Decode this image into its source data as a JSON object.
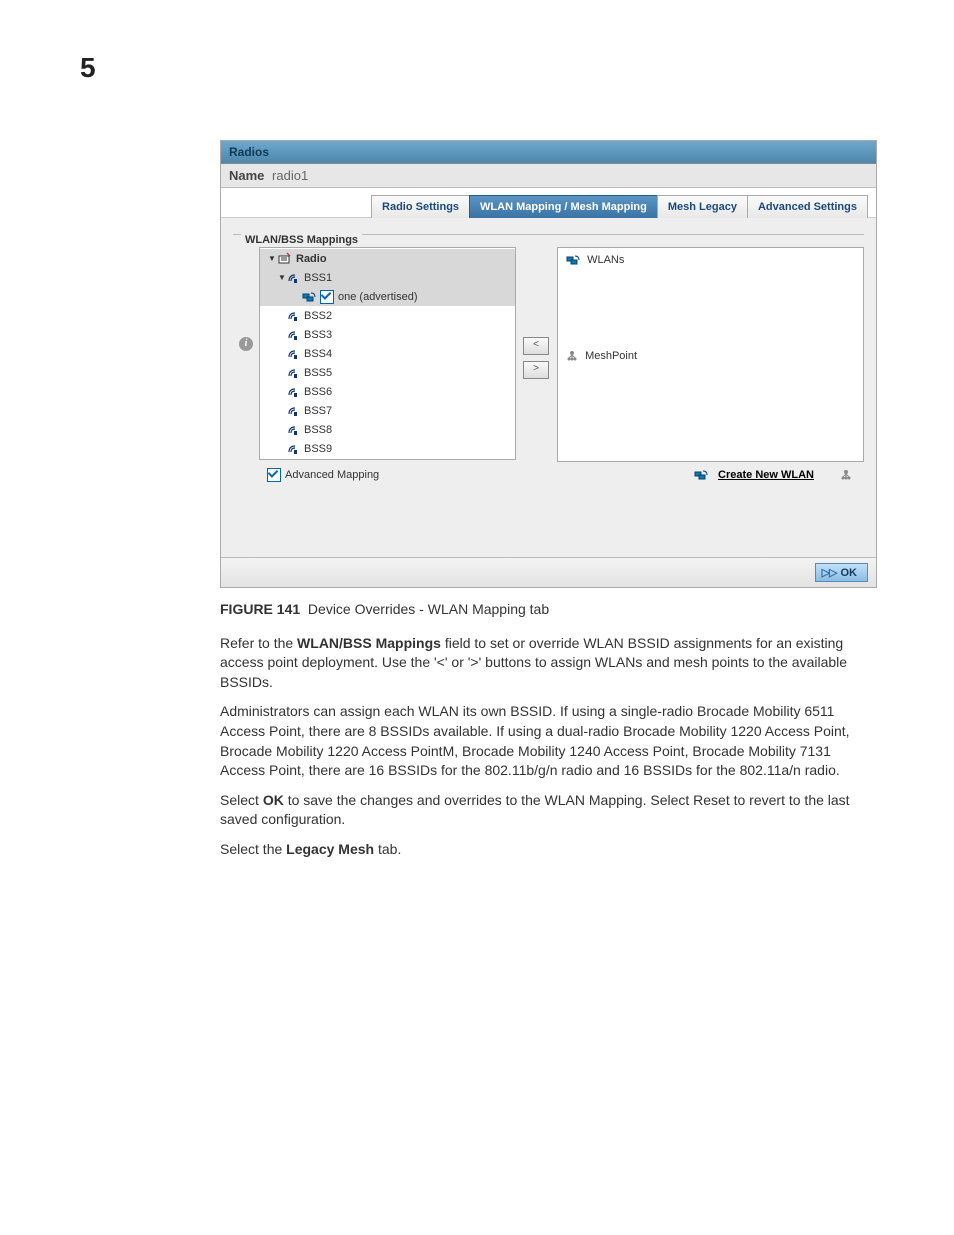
{
  "page_number": "5",
  "panel": {
    "title": "Radios",
    "name_label": "Name",
    "name_value": "radio1",
    "tabs": {
      "radio_settings": "Radio Settings",
      "wlan_mapping": "WLAN Mapping / Mesh Mapping",
      "mesh_legacy": "Mesh Legacy",
      "advanced": "Advanced Settings"
    },
    "fieldset_label": "WLAN/BSS Mappings",
    "tree": {
      "root": "Radio",
      "bss1": "BSS1",
      "bss1_child": "one (advertised)",
      "items": [
        "BSS2",
        "BSS3",
        "BSS4",
        "BSS5",
        "BSS6",
        "BSS7",
        "BSS8",
        "BSS9"
      ]
    },
    "right": {
      "wlans": "WLANs",
      "meshpoint": "MeshPoint"
    },
    "advanced_mapping": "Advanced Mapping",
    "create_link": "Create New WLAN",
    "ok": "OK"
  },
  "figure": {
    "num": "FIGURE 141",
    "caption": "Device Overrides - WLAN Mapping tab"
  },
  "paragraphs": {
    "p1a": "Refer to the ",
    "p1b": "WLAN/BSS Mappings",
    "p1c": " field to set or override WLAN BSSID assignments for an existing access point deployment. Use the '<' or '>' buttons to assign WLANs and mesh points to the available BSSIDs.",
    "p2": "Administrators can assign each WLAN its own BSSID. If using a single-radio Brocade Mobility 6511 Access Point, there are 8 BSSIDs available. If using a dual-radio Brocade Mobility 1220 Access Point, Brocade Mobility 1220 Access PointM, Brocade Mobility 1240 Access Point, Brocade Mobility 7131 Access Point, there are 16 BSSIDs for the 802.11b/g/n radio and 16 BSSIDs for the 802.11a/n radio.",
    "p3a": "Select ",
    "p3b": "OK",
    "p3c": " to save the changes and overrides to the WLAN Mapping. Select Reset to revert to the last saved configuration.",
    "p4a": "Select the  ",
    "p4b": "Legacy Mesh",
    "p4c": " tab."
  }
}
